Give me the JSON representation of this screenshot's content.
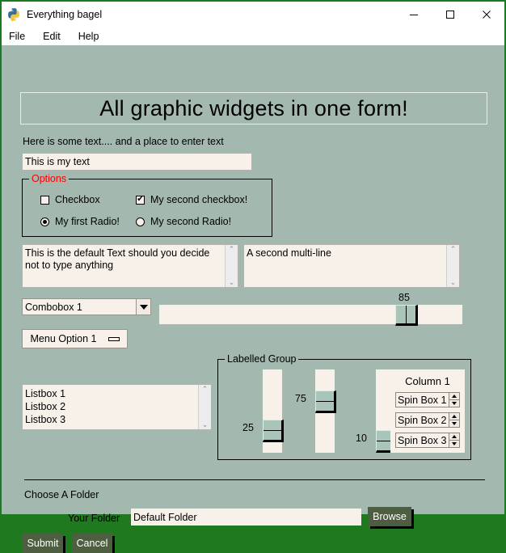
{
  "window": {
    "title": "Everything bagel",
    "icon": "python-logo-icon",
    "minimize_label": "minimize-icon",
    "maximize_label": "maximize-icon",
    "close_label": "close-icon"
  },
  "menubar": {
    "items": [
      {
        "label": "File"
      },
      {
        "label": "Edit"
      },
      {
        "label": "Help"
      }
    ]
  },
  "banner": {
    "text": "All graphic widgets in one form!"
  },
  "intro": {
    "text": "Here is some text.... and a place to enter text"
  },
  "text_input": {
    "value": "This is my text",
    "placeholder": ""
  },
  "options_frame": {
    "title": "Options",
    "title_color": "#ff0000",
    "checkboxes": [
      {
        "label": "Checkbox",
        "checked": false,
        "tick": ""
      },
      {
        "label": "My second checkbox!",
        "checked": true,
        "tick": "✔"
      }
    ],
    "radios": [
      {
        "label": "My first Radio!",
        "selected": true
      },
      {
        "label": "My second Radio!",
        "selected": false
      }
    ]
  },
  "multiline_left": {
    "value": "This is the default Text should you decide not to type anything",
    "scroll_up": "⌃",
    "scroll_down": "⌄"
  },
  "multiline_right": {
    "value": "A second multi-line",
    "scroll_up": "⌃",
    "scroll_down": "⌄"
  },
  "combobox": {
    "value": "Combobox 1"
  },
  "button_menu": {
    "label": "Menu Option 1"
  },
  "slider_horizontal": {
    "value": "85",
    "min": 0,
    "max": 100
  },
  "listbox": {
    "items": [
      {
        "label": "Listbox 1"
      },
      {
        "label": "Listbox 2"
      },
      {
        "label": "Listbox 3"
      }
    ],
    "scroll_up": "⌃",
    "scroll_down": "⌄"
  },
  "labelled_group": {
    "title": "Labelled Group",
    "sliders": [
      {
        "value": "25"
      },
      {
        "value": "75"
      },
      {
        "value": "10"
      }
    ],
    "column": {
      "title": "Column 1",
      "spin_boxes": [
        {
          "value": "Spin Box 1"
        },
        {
          "value": "Spin Box 2"
        },
        {
          "value": "Spin Box 3"
        }
      ]
    }
  },
  "folder_section": {
    "heading": "Choose A Folder",
    "field_label": "Your Folder",
    "field_value": "Default Folder",
    "browse_label": "Browse"
  },
  "footer": {
    "submit_label": "Submit",
    "cancel_label": "Cancel"
  },
  "colors": {
    "background": "#a3b8ae",
    "input_background": "#f7f1ea",
    "button_green": "#4e5e41",
    "frame_title_red": "#ff0000",
    "window_border": "#1c7a22"
  }
}
